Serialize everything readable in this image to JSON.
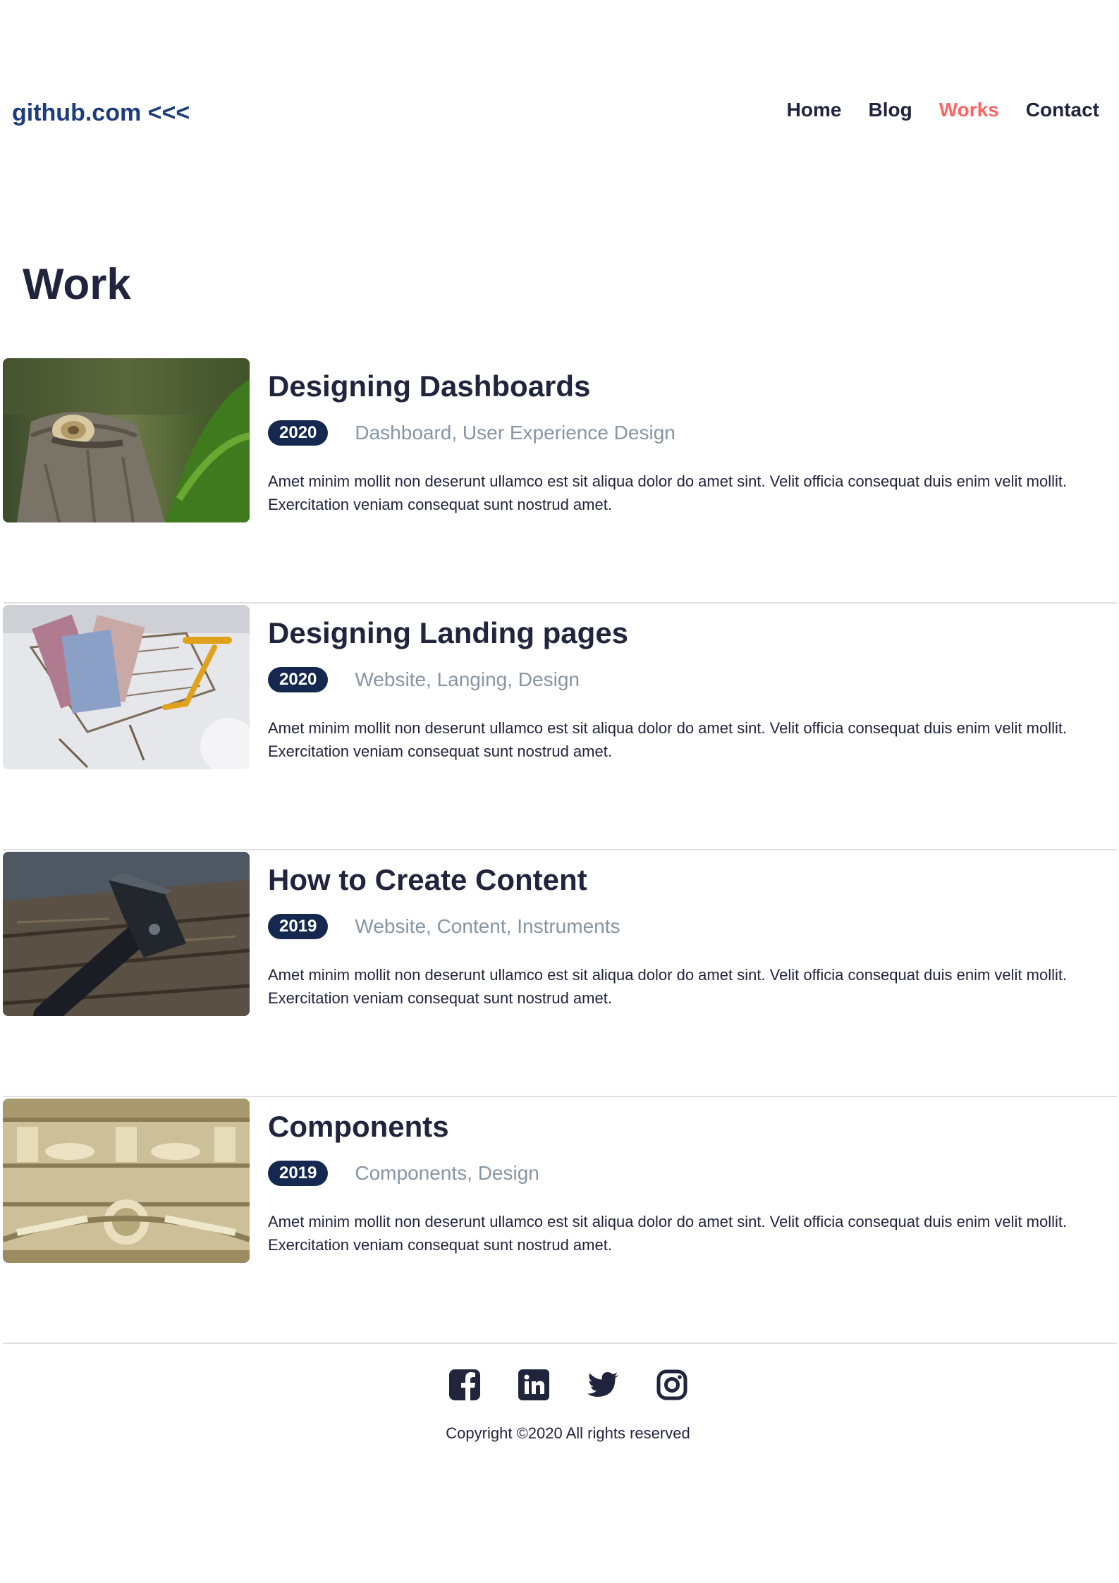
{
  "header": {
    "logo": "github.com <<<",
    "nav": [
      {
        "label": "Home",
        "active": false
      },
      {
        "label": "Blog",
        "active": false
      },
      {
        "label": "Works",
        "active": true
      },
      {
        "label": "Contact",
        "active": false
      }
    ],
    "active_color": "#ff6464"
  },
  "page_title": "Work",
  "works": [
    {
      "title": "Designing Dashboards",
      "year": "2020",
      "tags": "Dashboard, User Experience Design",
      "description": "Amet minim mollit non deserunt ullamco est sit aliqua dolor do amet sint. Velit officia consequat duis enim velit mollit. Exercitation veniam consequat sunt nostrud amet.",
      "image": "snail-on-tree-stump"
    },
    {
      "title": "Designing Landing pages",
      "year": "2020",
      "tags": "Website, Langing, Design",
      "description": "Amet minim mollit non deserunt ullamco est sit aliqua dolor do amet sint. Velit officia consequat duis enim velit mollit. Exercitation veniam consequat sunt nostrud amet.",
      "image": "euro-notes-in-shopping-cart"
    },
    {
      "title": "How to Create Content",
      "year": "2019",
      "tags": "Website, Content, Instruments",
      "description": "Amet minim mollit non deserunt ullamco est sit aliqua dolor do amet sint. Velit officia consequat duis enim velit mollit. Exercitation veniam consequat sunt nostrud amet.",
      "image": "hammer-on-wood"
    },
    {
      "title": "Components",
      "year": "2019",
      "tags": "Components, Design",
      "description": "Amet minim mollit non deserunt ullamco est sit aliqua dolor do amet sint. Velit officia consequat duis enim velit mollit. Exercitation veniam consequat sunt nostrud amet.",
      "image": "classical-stone-relief"
    }
  ],
  "footer": {
    "social": [
      "facebook-icon",
      "linkedin-icon",
      "twitter-icon",
      "instagram-icon"
    ],
    "copyright": "Copyright ©2020 All rights reserved"
  },
  "colors": {
    "badge": "#142850",
    "text": "#21243d",
    "tags": "#8695a4"
  }
}
